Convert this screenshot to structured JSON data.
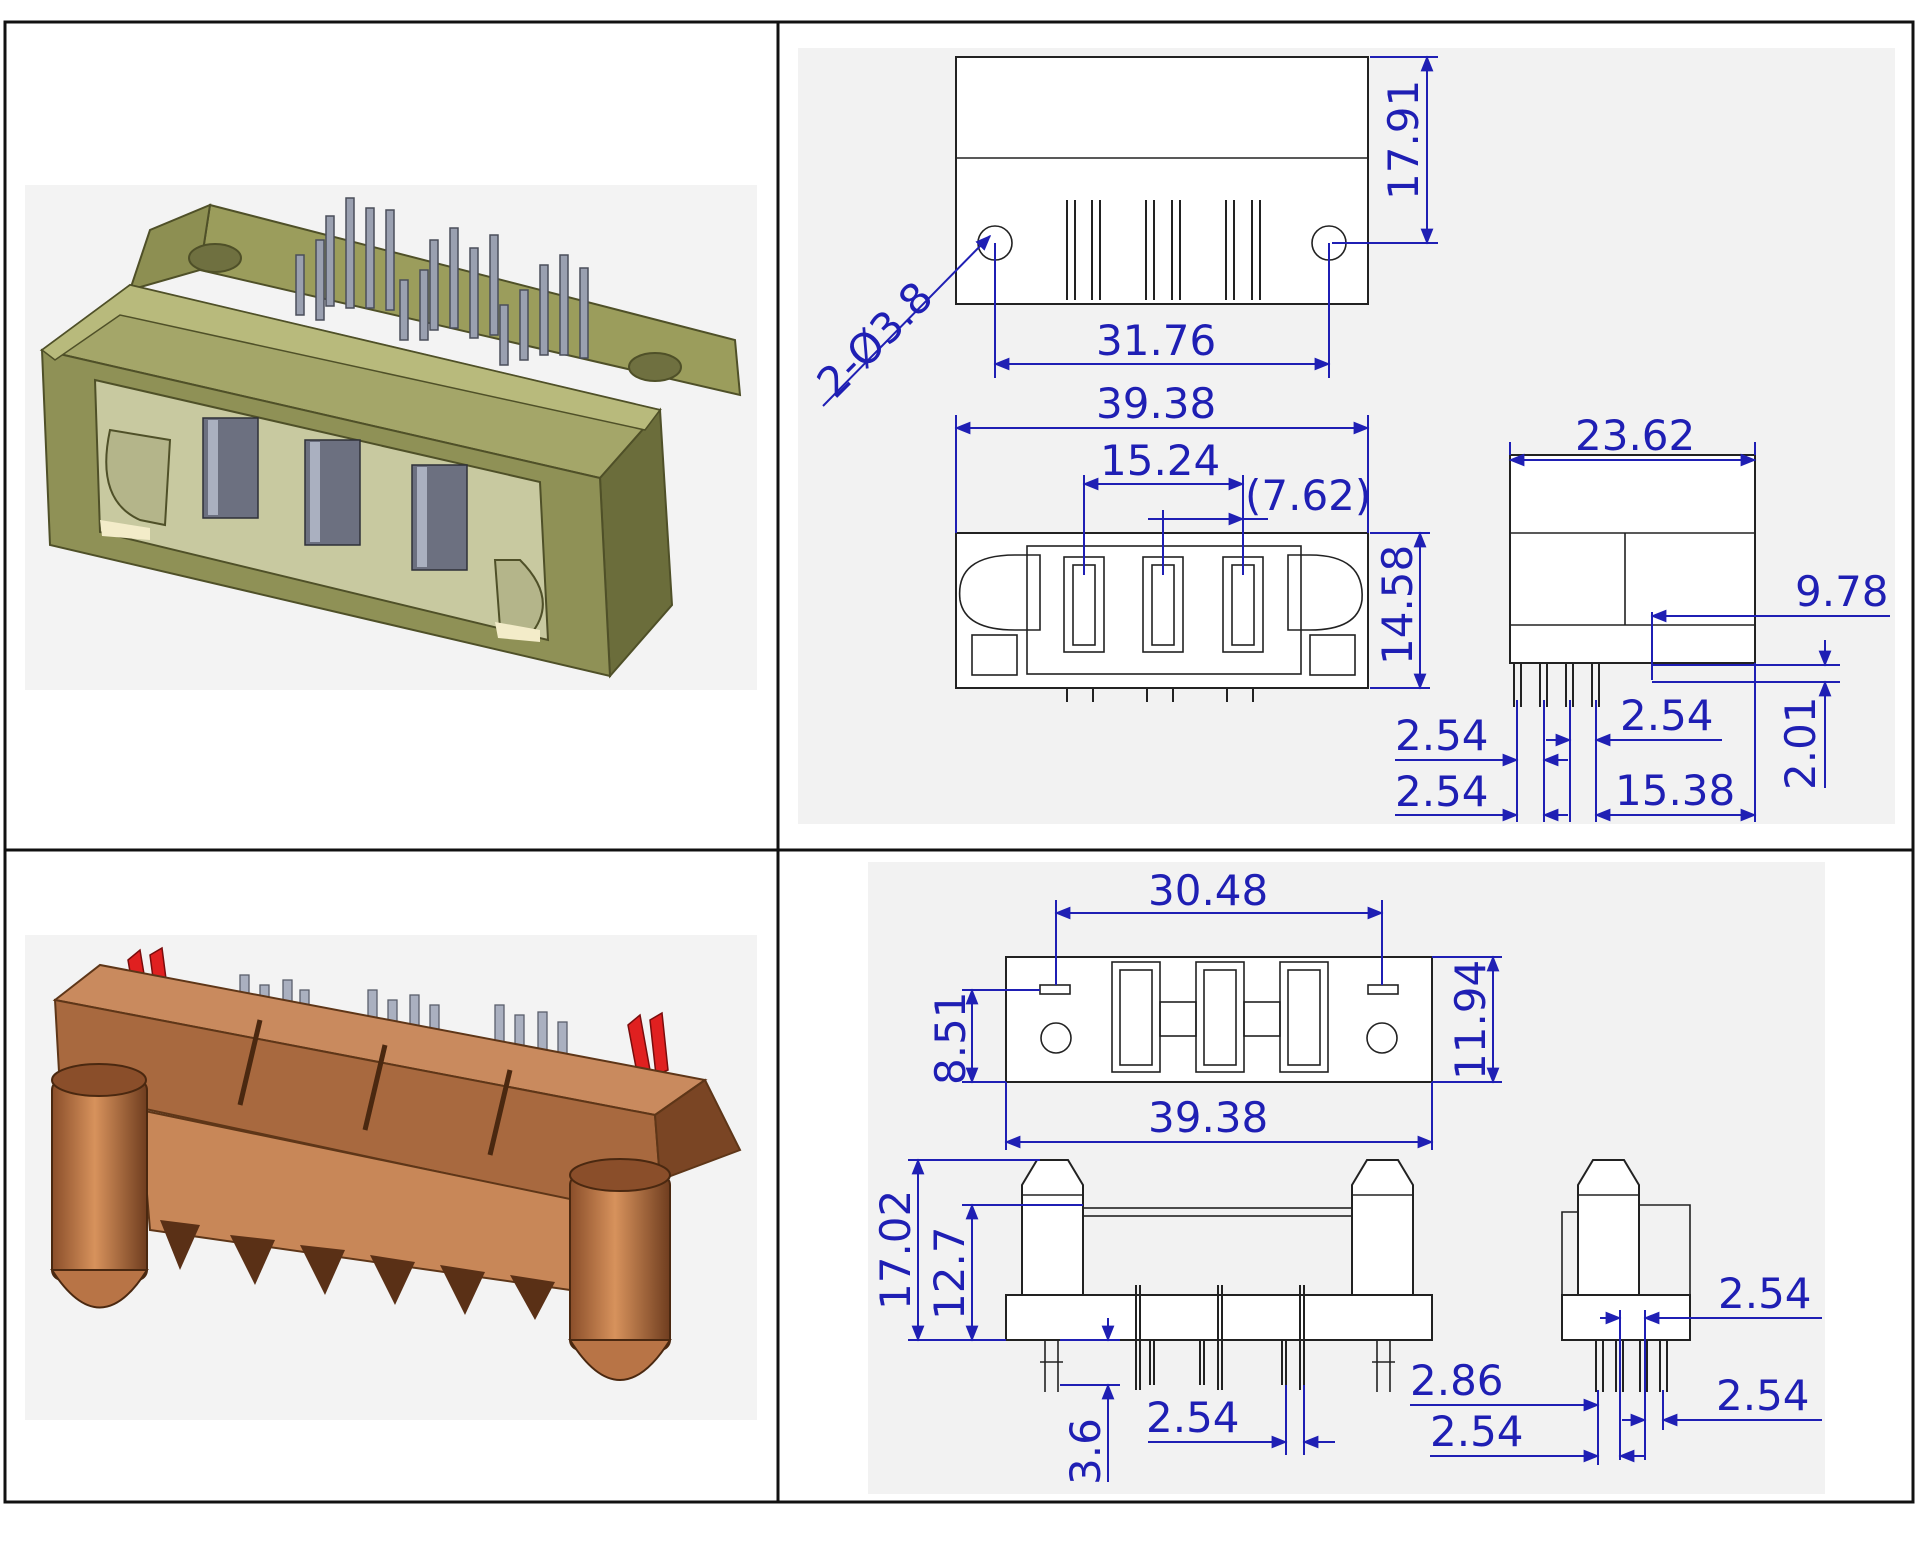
{
  "colors": {
    "dimension": "#1f1fb4",
    "connector_top": "#8a8c4e",
    "connector_bottom": "#c08458",
    "pin": "#9aa0b0",
    "latch": "#e02020"
  },
  "panels": {
    "top_left": {
      "icon": "connector-3d-green-icon"
    },
    "top_right": {
      "dims": {
        "d1791": "17.91",
        "dia38": "2-Ø3.8",
        "d3176": "31.76",
        "d3938": "39.38",
        "d1524": "15.24",
        "d762": "(7.62)",
        "d1458": "14.58",
        "d2362": "23.62",
        "d978": "9.78",
        "d254a": "2.54",
        "d254b": "2.54",
        "d254c": "2.54",
        "d201": "2.01",
        "d1538": "15.38"
      }
    },
    "bottom_left": {
      "icon": "connector-3d-copper-icon"
    },
    "bottom_right": {
      "dims": {
        "d3048": "30.48",
        "d851": "8.51",
        "d1194": "11.94",
        "d3938": "39.38",
        "d1702": "17.02",
        "d127": "12.7",
        "d36": "3.6",
        "d254a": "2.54",
        "d286": "2.86",
        "d254b": "2.54",
        "d254c": "2.54",
        "d254d": "2.54"
      }
    }
  }
}
